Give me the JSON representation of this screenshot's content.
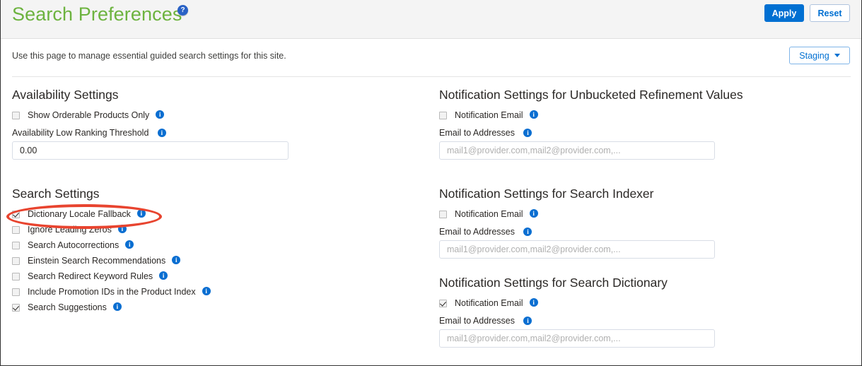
{
  "header": {
    "title": "Search Preferences",
    "help_icon": "help-circle-icon",
    "apply_label": "Apply",
    "reset_label": "Reset"
  },
  "subheader": {
    "description": "Use this page to manage essential guided search settings for this site.",
    "environment_label": "Staging"
  },
  "left_column": {
    "availability": {
      "title": "Availability Settings",
      "show_orderable_label": "Show Orderable Products Only",
      "show_orderable_checked": false,
      "threshold_label": "Availability Low Ranking Threshold",
      "threshold_value": "0.00"
    },
    "search_settings": {
      "title": "Search Settings",
      "options": [
        {
          "label": "Dictionary Locale Fallback",
          "checked": true
        },
        {
          "label": "Ignore Leading Zeros",
          "checked": false
        },
        {
          "label": "Search Autocorrections",
          "checked": false
        },
        {
          "label": "Einstein Search Recommendations",
          "checked": false
        },
        {
          "label": "Search Redirect Keyword Rules",
          "checked": false
        },
        {
          "label": "Include Promotion IDs in the Product Index",
          "checked": false
        },
        {
          "label": "Search Suggestions",
          "checked": true
        }
      ]
    }
  },
  "right_column": {
    "sections": [
      {
        "title": "Notification Settings for Unbucketed Refinement Values",
        "notification_email_label": "Notification Email",
        "notification_email_checked": false,
        "email_addresses_label": "Email to Addresses",
        "email_addresses_value": "",
        "email_addresses_placeholder": "mail1@provider.com,mail2@provider.com,..."
      },
      {
        "title": "Notification Settings for Search Indexer",
        "notification_email_label": "Notification Email",
        "notification_email_checked": false,
        "email_addresses_label": "Email to Addresses",
        "email_addresses_value": "",
        "email_addresses_placeholder": "mail1@provider.com,mail2@provider.com,..."
      },
      {
        "title": "Notification Settings for Search Dictionary",
        "notification_email_label": "Notification Email",
        "notification_email_checked": true,
        "email_addresses_label": "Email to Addresses",
        "email_addresses_value": "",
        "email_addresses_placeholder": "mail1@provider.com,mail2@provider.com,..."
      }
    ]
  },
  "annotation": {
    "type": "ellipse-highlight",
    "color": "#e8442f",
    "target": "Dictionary Locale Fallback"
  },
  "icons": {
    "info": "i",
    "help": "?"
  },
  "colors": {
    "title_green": "#6db33f",
    "primary_blue": "#0070d2",
    "info_blue": "#0a6ed1",
    "annotation_red": "#e8442f"
  }
}
